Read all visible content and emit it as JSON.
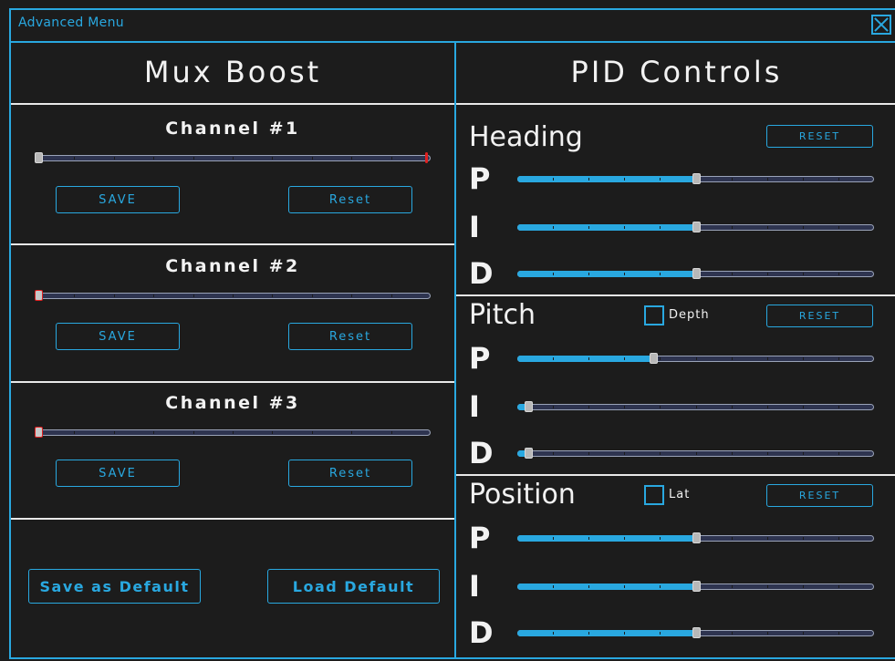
{
  "window": {
    "title": "Advanced Menu"
  },
  "mux_boost": {
    "title": "Mux Boost",
    "channels": [
      {
        "title": "Channel #1",
        "value": 1.0,
        "save_label": "SAVE",
        "reset_label": "Reset"
      },
      {
        "title": "Channel #2",
        "value": 0.0,
        "save_label": "SAVE",
        "reset_label": "Reset"
      },
      {
        "title": "Channel #3",
        "value": 0.0,
        "save_label": "SAVE",
        "reset_label": "Reset"
      }
    ],
    "save_default_label": "Save as Default",
    "load_default_label": "Load Default"
  },
  "pid": {
    "title": "PID Controls",
    "sections": [
      {
        "title": "Heading",
        "reset_label": "RESET",
        "checkbox": null,
        "sliders": [
          {
            "label": "P",
            "value": 0.5
          },
          {
            "label": "I",
            "value": 0.5
          },
          {
            "label": "D",
            "value": 0.5
          }
        ]
      },
      {
        "title": "Pitch",
        "reset_label": "RESET",
        "checkbox": {
          "label": "Depth",
          "checked": false
        },
        "sliders": [
          {
            "label": "P",
            "value": 0.38
          },
          {
            "label": "I",
            "value": 0.03
          },
          {
            "label": "D",
            "value": 0.03
          }
        ]
      },
      {
        "title": "Position",
        "reset_label": "RESET",
        "checkbox": {
          "label": "Lat",
          "checked": false
        },
        "sliders": [
          {
            "label": "P",
            "value": 0.5
          },
          {
            "label": "I",
            "value": 0.5
          },
          {
            "label": "D",
            "value": 0.5
          }
        ]
      }
    ]
  },
  "colors": {
    "accent": "#29a8e0",
    "background": "#1c1c1c",
    "track": "#2e3450"
  }
}
